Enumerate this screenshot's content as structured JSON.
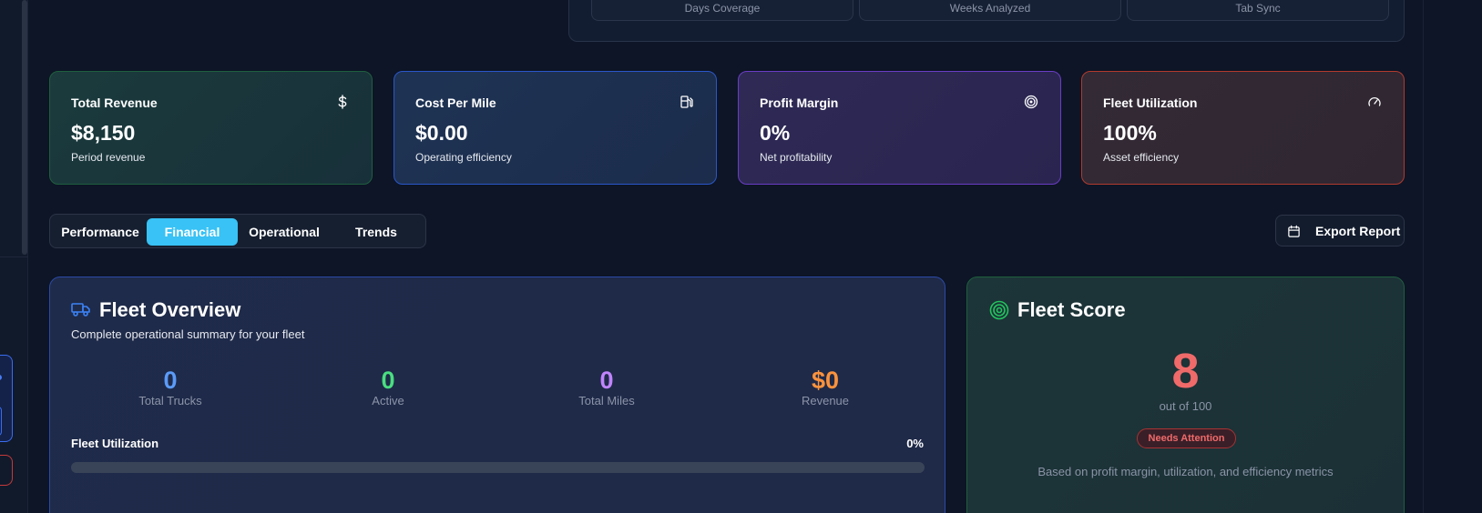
{
  "top_stats": [
    {
      "label": "Days Coverage"
    },
    {
      "label": "Weeks Analyzed"
    },
    {
      "label": "Tab Sync"
    }
  ],
  "kpis": [
    {
      "label": "Total Revenue",
      "value": "$8,150",
      "sub": "Period revenue",
      "icon": "dollar-icon",
      "color": "#1f5f3e"
    },
    {
      "label": "Cost Per Mile",
      "value": "$0.00",
      "sub": "Operating efficiency",
      "icon": "fuel-icon",
      "color": "#2a56c9"
    },
    {
      "label": "Profit Margin",
      "value": "0%",
      "sub": "Net profitability",
      "icon": "target-icon",
      "color": "#6a3cc4"
    },
    {
      "label": "Fleet Utilization",
      "value": "100%",
      "sub": "Asset efficiency",
      "icon": "gauge-icon",
      "color": "#b23a2e"
    }
  ],
  "tabs": [
    {
      "label": "Performance",
      "active": false
    },
    {
      "label": "Financial",
      "active": true
    },
    {
      "label": "Operational",
      "active": false
    },
    {
      "label": "Trends",
      "active": false
    }
  ],
  "export": {
    "label": "Export Report",
    "icon": "calendar-icon"
  },
  "overview": {
    "title": "Fleet Overview",
    "subtitle": "Complete operational summary for your fleet",
    "icon": "truck-icon",
    "stats": [
      {
        "value": "0",
        "label": "Total Trucks",
        "color": "#5b9bf8"
      },
      {
        "value": "0",
        "label": "Active",
        "color": "#4ade80"
      },
      {
        "value": "0",
        "label": "Total Miles",
        "color": "#c084fc"
      },
      {
        "value": "$0",
        "label": "Revenue",
        "color": "#fb923c"
      }
    ],
    "utilization_label": "Fleet Utilization",
    "utilization_value": "0%",
    "utilization_fraction": 0
  },
  "score": {
    "title": "Fleet Score",
    "icon": "target-icon",
    "value": "8",
    "out_of": "out of 100",
    "badge": "Needs Attention",
    "note": "Based on profit margin, utilization, and efficiency metrics"
  },
  "colors": {
    "accent": "#38c2f5",
    "score": "#f06a6a",
    "score_icon": "#22c55e",
    "truck_icon": "#3b82f6"
  }
}
